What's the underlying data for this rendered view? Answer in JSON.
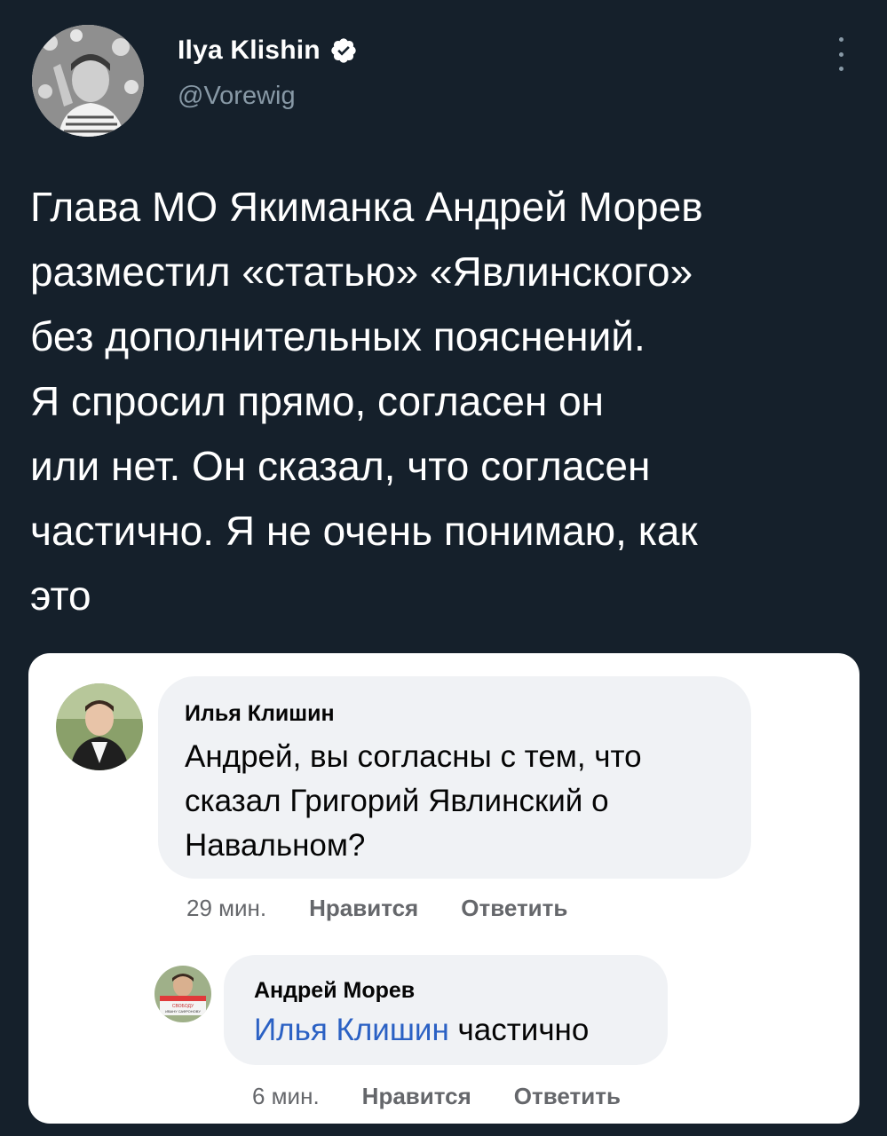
{
  "tweet": {
    "author_name": "Ilya Klishin",
    "handle": "@Vorewig",
    "text_lines": [
      "Глава МО Якиманка Андрей Морев",
      "разместил «статью» «Явлинского»",
      "без дополнительных пояснений.",
      "Я спросил прямо, согласен он",
      "или нет. Он сказал, что согласен",
      "частично. Я не очень понимаю, как",
      "это"
    ]
  },
  "embedded": {
    "comment": {
      "author": "Илья Клишин",
      "lines": [
        "Андрей, вы согласны с тем, что",
        "сказал Григорий Явлинский о",
        "Навальном?"
      ],
      "time": "29 мин.",
      "like": "Нравится",
      "reply": "Ответить"
    },
    "reply": {
      "author": "Андрей Морев",
      "mention": "Илья Клишин",
      "text": " частично",
      "time": "6 мин.",
      "like": "Нравится",
      "reply": "Ответить",
      "avatar_sign_text": "СВОБОДУ ИВАНУ САФРОНОВУ"
    }
  },
  "colors": {
    "background": "#15202b",
    "text": "#ffffff",
    "secondary": "#8899a6",
    "verified": "#ffffff",
    "mention": "#2b61c4"
  }
}
